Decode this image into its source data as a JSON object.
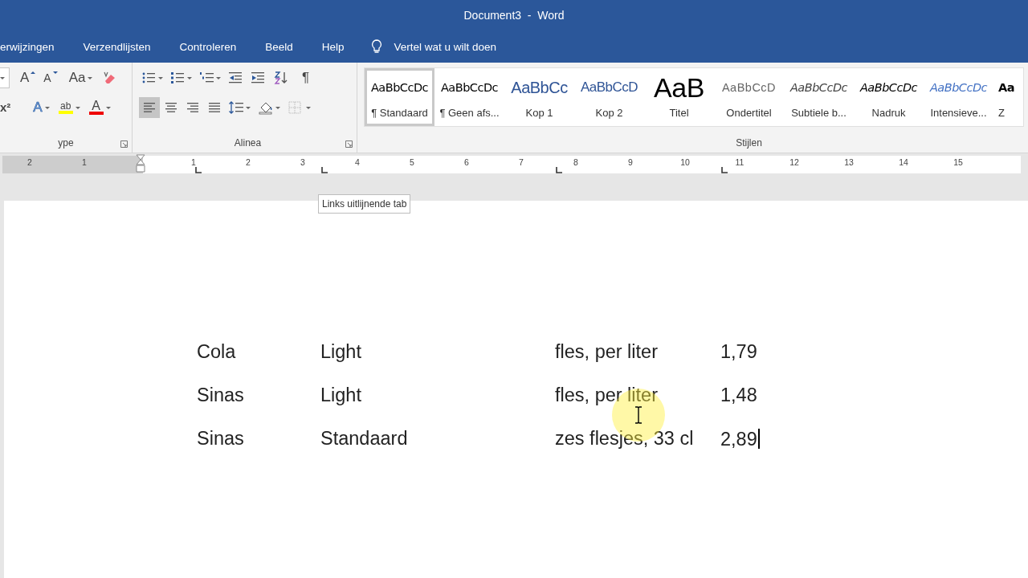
{
  "window": {
    "title": "Document3  -  Word"
  },
  "ribbon_tabs": [
    {
      "label": "erwijzingen"
    },
    {
      "label": "Verzendlijsten"
    },
    {
      "label": "Controleren"
    },
    {
      "label": "Beeld"
    },
    {
      "label": "Help"
    }
  ],
  "tell_me": {
    "placeholder": "Vertel wat u wilt doen"
  },
  "font_group": {
    "label": "ype",
    "grow": "A",
    "shrink": "A",
    "change_case": "Aa",
    "superscript": "x²",
    "text_effects": "A",
    "highlight": "ab",
    "font_color": "A"
  },
  "paragraph_group": {
    "label": "Alinea",
    "show_marks": "¶",
    "alignment": [
      {
        "kind": "left",
        "selected": true
      },
      {
        "kind": "center",
        "selected": false
      },
      {
        "kind": "right",
        "selected": false
      },
      {
        "kind": "justify",
        "selected": false
      }
    ]
  },
  "styles": {
    "label": "Stijlen",
    "items": [
      {
        "preview": "AaBbCcDc",
        "name": "¶ Standaard",
        "kind": "normal",
        "selected": true
      },
      {
        "preview": "AaBbCcDc",
        "name": "¶ Geen afs...",
        "kind": "normal",
        "selected": false
      },
      {
        "preview": "AaBbCc",
        "name": "Kop 1",
        "kind": "heading1",
        "selected": false
      },
      {
        "preview": "AaBbCcD",
        "name": "Kop 2",
        "kind": "heading2",
        "selected": false
      },
      {
        "preview": "AaB",
        "name": "Titel",
        "kind": "title",
        "selected": false
      },
      {
        "preview": "AaBbCcD",
        "name": "Ondertitel",
        "kind": "subtitle",
        "selected": false
      },
      {
        "preview": "AaBbCcDc",
        "name": "Subtiele b...",
        "kind": "subtle",
        "selected": false
      },
      {
        "preview": "AaBbCcDc",
        "name": "Nadruk",
        "kind": "emphasis",
        "selected": false
      },
      {
        "preview": "AaBbCcDc",
        "name": "Intensieve...",
        "kind": "intense",
        "selected": false
      },
      {
        "preview": "Aa",
        "name": "Z",
        "kind": "strong",
        "selected": false
      }
    ]
  },
  "ruler": {
    "labels": [
      "2",
      "1",
      "1",
      "2",
      "3",
      "4",
      "5",
      "6",
      "7",
      "8",
      "9",
      "10",
      "11",
      "12",
      "13",
      "14",
      "15"
    ]
  },
  "tooltip": "Links uitlijnende tab",
  "document": {
    "rows": [
      {
        "cells": [
          "Cola",
          "Light",
          "fles, per liter",
          "1,79"
        ]
      },
      {
        "cells": [
          "Sinas",
          "Light",
          "fles, per liter",
          "1,48"
        ]
      },
      {
        "cells": [
          "Sinas",
          "Standaard",
          "zes flesjes, 33 cl",
          "2,89"
        ]
      }
    ],
    "caret_in_last_cell": true
  }
}
